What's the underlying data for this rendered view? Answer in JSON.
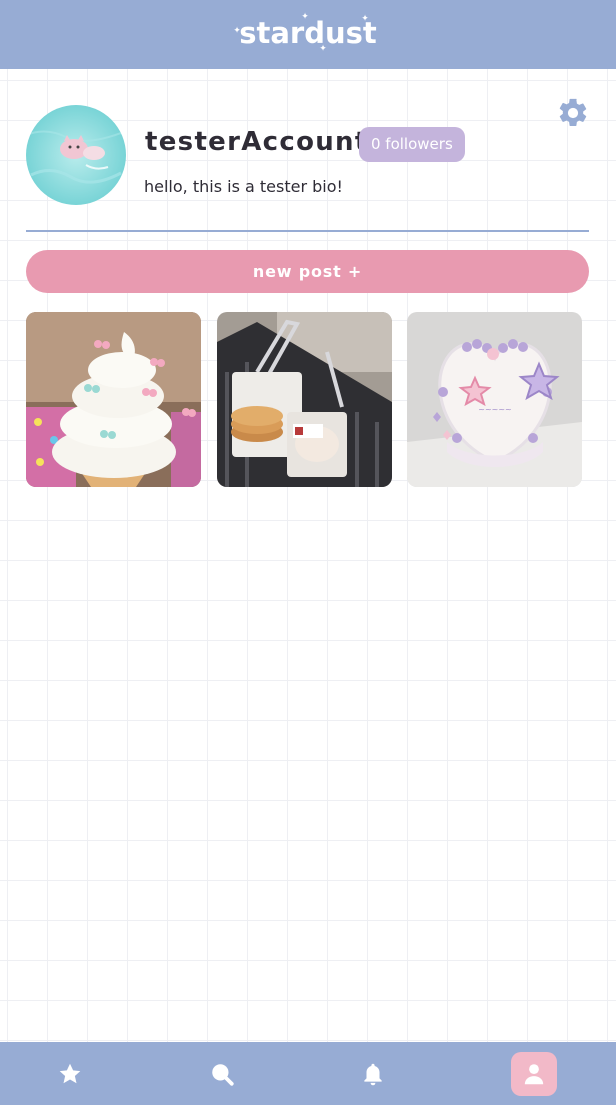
{
  "header": {
    "logo_text": "stardust"
  },
  "profile": {
    "username": "testerAccount",
    "followers_label": "0 followers",
    "bio": "hello, this is a tester bio!"
  },
  "actions": {
    "new_post_label": "new post +"
  },
  "posts": [
    {
      "subject": "soft serve ice cream with bows"
    },
    {
      "subject": "pancakes in a shopping basket"
    },
    {
      "subject": "heart shaped cake with purple stars"
    }
  ],
  "bottom_nav": {
    "items": [
      {
        "icon": "star-icon",
        "active": false
      },
      {
        "icon": "search-icon",
        "active": false
      },
      {
        "icon": "bell-icon",
        "active": false
      },
      {
        "icon": "user-icon",
        "active": true
      }
    ]
  },
  "colors": {
    "header_bg": "#97acd4",
    "accent_pink": "#e89ab0",
    "followers_badge": "#c4b4dc",
    "active_nav": "#f2b9c8",
    "text_dark": "#2f2c36"
  }
}
